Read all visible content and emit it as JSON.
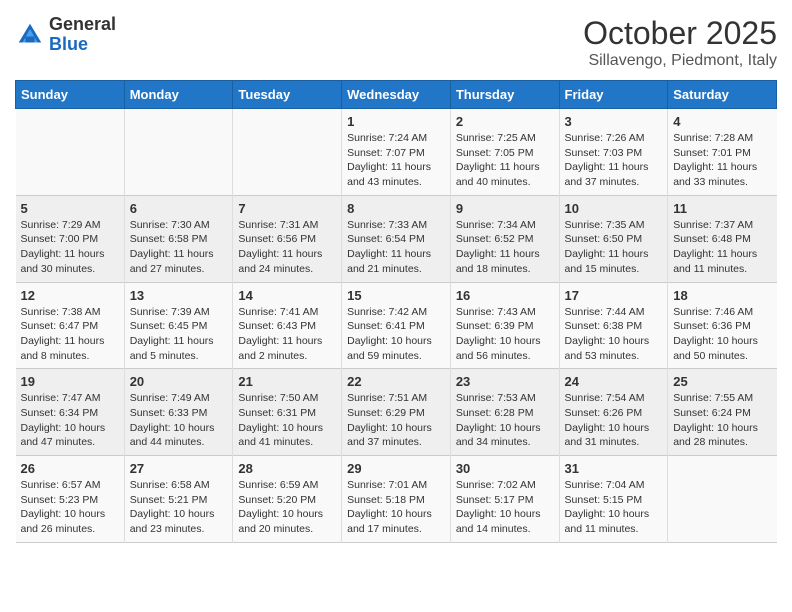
{
  "header": {
    "logo_general": "General",
    "logo_blue": "Blue",
    "month_title": "October 2025",
    "location": "Sillavengo, Piedmont, Italy"
  },
  "days_of_week": [
    "Sunday",
    "Monday",
    "Tuesday",
    "Wednesday",
    "Thursday",
    "Friday",
    "Saturday"
  ],
  "weeks": [
    [
      {
        "num": "",
        "info": ""
      },
      {
        "num": "",
        "info": ""
      },
      {
        "num": "",
        "info": ""
      },
      {
        "num": "1",
        "info": "Sunrise: 7:24 AM\nSunset: 7:07 PM\nDaylight: 11 hours\nand 43 minutes."
      },
      {
        "num": "2",
        "info": "Sunrise: 7:25 AM\nSunset: 7:05 PM\nDaylight: 11 hours\nand 40 minutes."
      },
      {
        "num": "3",
        "info": "Sunrise: 7:26 AM\nSunset: 7:03 PM\nDaylight: 11 hours\nand 37 minutes."
      },
      {
        "num": "4",
        "info": "Sunrise: 7:28 AM\nSunset: 7:01 PM\nDaylight: 11 hours\nand 33 minutes."
      }
    ],
    [
      {
        "num": "5",
        "info": "Sunrise: 7:29 AM\nSunset: 7:00 PM\nDaylight: 11 hours\nand 30 minutes."
      },
      {
        "num": "6",
        "info": "Sunrise: 7:30 AM\nSunset: 6:58 PM\nDaylight: 11 hours\nand 27 minutes."
      },
      {
        "num": "7",
        "info": "Sunrise: 7:31 AM\nSunset: 6:56 PM\nDaylight: 11 hours\nand 24 minutes."
      },
      {
        "num": "8",
        "info": "Sunrise: 7:33 AM\nSunset: 6:54 PM\nDaylight: 11 hours\nand 21 minutes."
      },
      {
        "num": "9",
        "info": "Sunrise: 7:34 AM\nSunset: 6:52 PM\nDaylight: 11 hours\nand 18 minutes."
      },
      {
        "num": "10",
        "info": "Sunrise: 7:35 AM\nSunset: 6:50 PM\nDaylight: 11 hours\nand 15 minutes."
      },
      {
        "num": "11",
        "info": "Sunrise: 7:37 AM\nSunset: 6:48 PM\nDaylight: 11 hours\nand 11 minutes."
      }
    ],
    [
      {
        "num": "12",
        "info": "Sunrise: 7:38 AM\nSunset: 6:47 PM\nDaylight: 11 hours\nand 8 minutes."
      },
      {
        "num": "13",
        "info": "Sunrise: 7:39 AM\nSunset: 6:45 PM\nDaylight: 11 hours\nand 5 minutes."
      },
      {
        "num": "14",
        "info": "Sunrise: 7:41 AM\nSunset: 6:43 PM\nDaylight: 11 hours\nand 2 minutes."
      },
      {
        "num": "15",
        "info": "Sunrise: 7:42 AM\nSunset: 6:41 PM\nDaylight: 10 hours\nand 59 minutes."
      },
      {
        "num": "16",
        "info": "Sunrise: 7:43 AM\nSunset: 6:39 PM\nDaylight: 10 hours\nand 56 minutes."
      },
      {
        "num": "17",
        "info": "Sunrise: 7:44 AM\nSunset: 6:38 PM\nDaylight: 10 hours\nand 53 minutes."
      },
      {
        "num": "18",
        "info": "Sunrise: 7:46 AM\nSunset: 6:36 PM\nDaylight: 10 hours\nand 50 minutes."
      }
    ],
    [
      {
        "num": "19",
        "info": "Sunrise: 7:47 AM\nSunset: 6:34 PM\nDaylight: 10 hours\nand 47 minutes."
      },
      {
        "num": "20",
        "info": "Sunrise: 7:49 AM\nSunset: 6:33 PM\nDaylight: 10 hours\nand 44 minutes."
      },
      {
        "num": "21",
        "info": "Sunrise: 7:50 AM\nSunset: 6:31 PM\nDaylight: 10 hours\nand 41 minutes."
      },
      {
        "num": "22",
        "info": "Sunrise: 7:51 AM\nSunset: 6:29 PM\nDaylight: 10 hours\nand 37 minutes."
      },
      {
        "num": "23",
        "info": "Sunrise: 7:53 AM\nSunset: 6:28 PM\nDaylight: 10 hours\nand 34 minutes."
      },
      {
        "num": "24",
        "info": "Sunrise: 7:54 AM\nSunset: 6:26 PM\nDaylight: 10 hours\nand 31 minutes."
      },
      {
        "num": "25",
        "info": "Sunrise: 7:55 AM\nSunset: 6:24 PM\nDaylight: 10 hours\nand 28 minutes."
      }
    ],
    [
      {
        "num": "26",
        "info": "Sunrise: 6:57 AM\nSunset: 5:23 PM\nDaylight: 10 hours\nand 26 minutes."
      },
      {
        "num": "27",
        "info": "Sunrise: 6:58 AM\nSunset: 5:21 PM\nDaylight: 10 hours\nand 23 minutes."
      },
      {
        "num": "28",
        "info": "Sunrise: 6:59 AM\nSunset: 5:20 PM\nDaylight: 10 hours\nand 20 minutes."
      },
      {
        "num": "29",
        "info": "Sunrise: 7:01 AM\nSunset: 5:18 PM\nDaylight: 10 hours\nand 17 minutes."
      },
      {
        "num": "30",
        "info": "Sunrise: 7:02 AM\nSunset: 5:17 PM\nDaylight: 10 hours\nand 14 minutes."
      },
      {
        "num": "31",
        "info": "Sunrise: 7:04 AM\nSunset: 5:15 PM\nDaylight: 10 hours\nand 11 minutes."
      },
      {
        "num": "",
        "info": ""
      }
    ]
  ]
}
